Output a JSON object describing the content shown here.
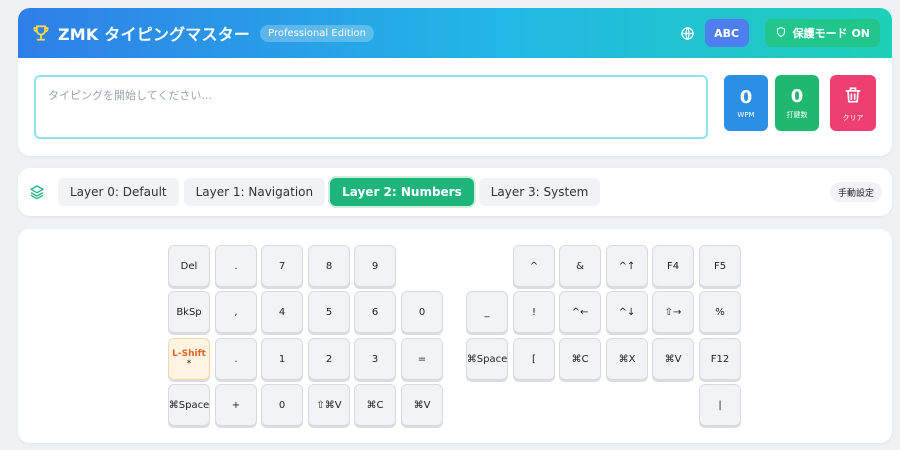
{
  "header": {
    "title": "ZMK タイピングマスター",
    "edition": "Professional Edition",
    "abc_label": "ABC",
    "protect_label": "保護モード ON",
    "icons": {
      "logo": "trophy-icon",
      "language": "globe-icon",
      "protect": "shield-icon"
    }
  },
  "input": {
    "placeholder": "タイピングを開始してください...",
    "value": ""
  },
  "stats": {
    "wpm_value": "0",
    "wpm_label": "WPM",
    "strokes_value": "0",
    "strokes_label": "打鍵数",
    "clear_label": "クリア"
  },
  "layers": {
    "tabs": [
      {
        "label": "Layer 0: Default"
      },
      {
        "label": "Layer 1: Navigation"
      },
      {
        "label": "Layer 2: Numbers"
      },
      {
        "label": "Layer 3: System"
      }
    ],
    "active_index": 2,
    "manual_label": "手動設定"
  },
  "keyboard": {
    "left": [
      [
        "Del",
        ".",
        "7",
        "8",
        "9",
        ""
      ],
      [
        "BkSp",
        ",",
        "4",
        "5",
        "6",
        "0"
      ],
      [
        "L-Shift",
        ".",
        "1",
        "2",
        "3",
        "="
      ],
      [
        "⌘Space",
        "+",
        "0",
        "⇧⌘V",
        "⌘C",
        "⌘V"
      ]
    ],
    "shift_sublabel": "*",
    "right": [
      [
        "",
        "^",
        "&",
        "^↑",
        "F4",
        "F5"
      ],
      [
        "_",
        "!",
        "^←",
        "^↓",
        "⇧→",
        "%"
      ],
      [
        "⌘Space",
        "[",
        "⌘C",
        "⌘X",
        "⌘V",
        "F12"
      ],
      [
        "",
        "",
        "",
        "",
        "",
        "|"
      ]
    ]
  },
  "colors": {
    "accent_green": "#1eb47c",
    "wpm_blue": "#2b8fe6",
    "clear_pink": "#ee4070",
    "shift_orange": "#e0661f"
  }
}
